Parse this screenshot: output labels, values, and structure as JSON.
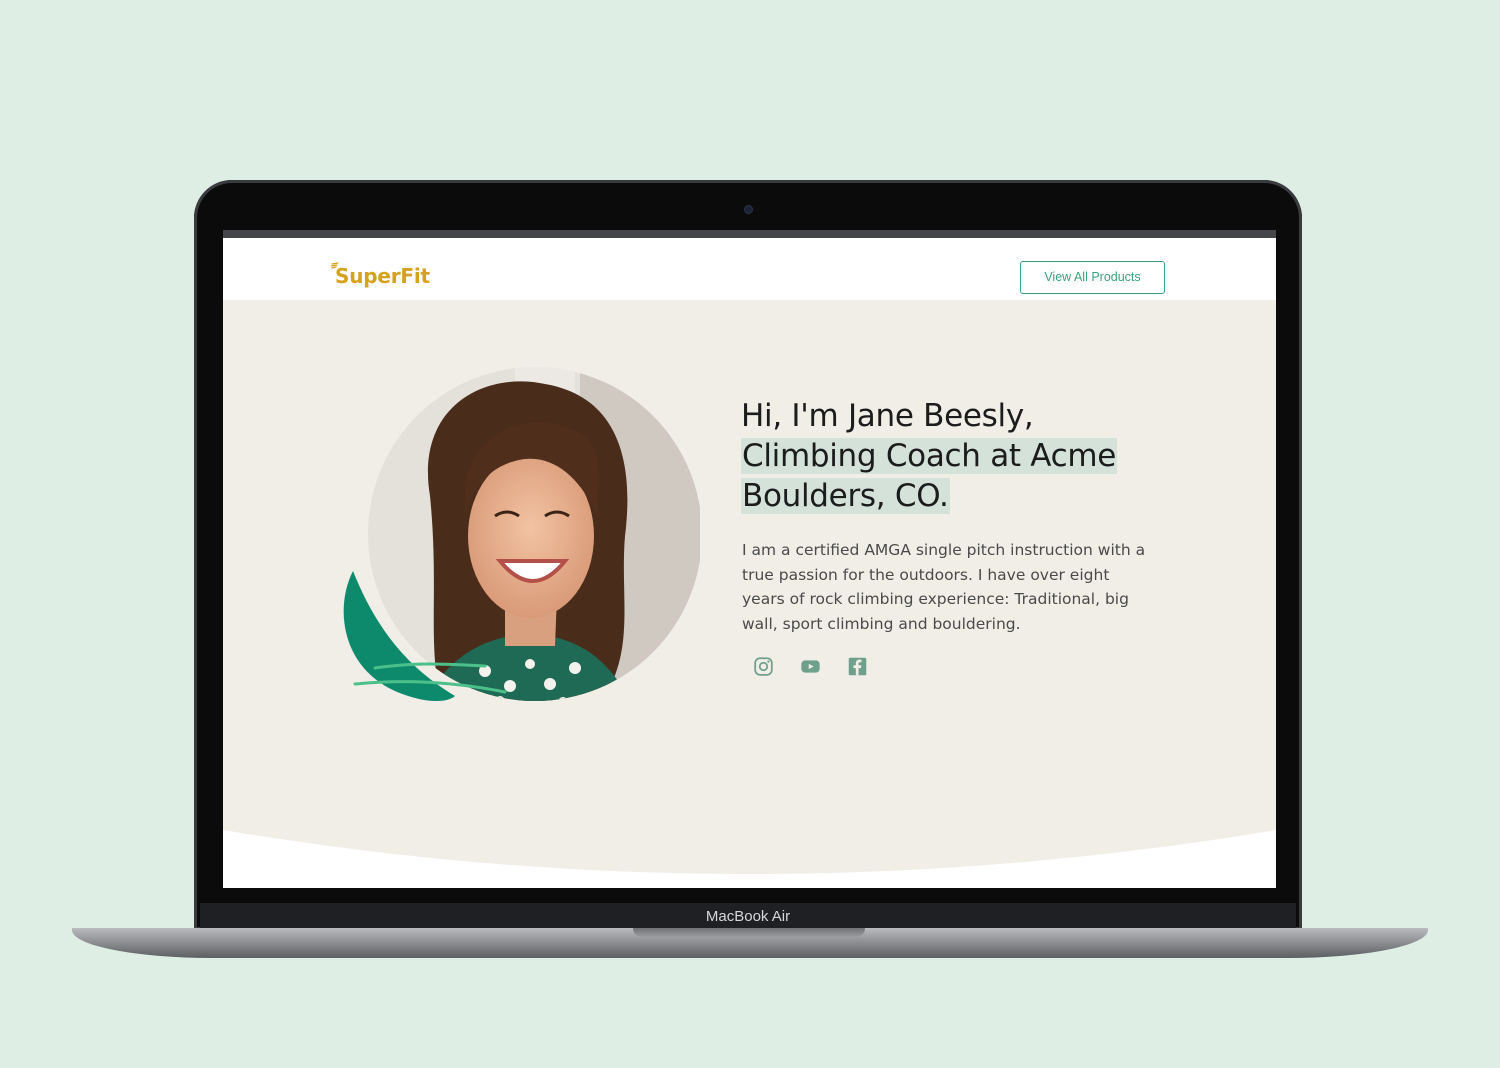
{
  "device": {
    "label": "MacBook Air"
  },
  "site": {
    "logo": "SuperFit",
    "nav_button_label": "View All Products",
    "accent_color": "#3aa37b",
    "logo_color": "#d6a21c",
    "hero_background": "#f1eee8",
    "page_background": "#deeee5"
  },
  "hero": {
    "headline_line1": "Hi, I'm Jane Beesly,",
    "headline_highlight_1": "Climbing Coach at Acme",
    "headline_highlight_2": "Boulders, CO.",
    "bio": "I am a certified AMGA single pitch instruction with a true passion for the outdoors. I have over eight years of rock climbing experience: Traditional, big wall, sport climbing and bouldering.",
    "photo": "portrait-smiling-woman",
    "socials": [
      {
        "icon": "instagram-icon"
      },
      {
        "icon": "youtube-icon"
      },
      {
        "icon": "facebook-icon"
      }
    ]
  }
}
